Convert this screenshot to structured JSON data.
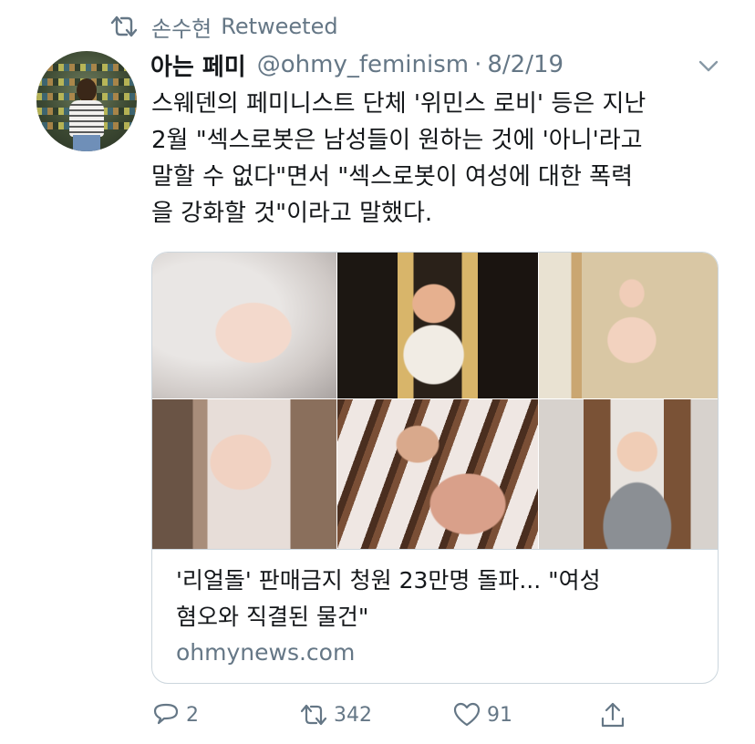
{
  "retweet": {
    "icon": "retweet-icon",
    "user": "손수현",
    "label": "Retweeted"
  },
  "tweet": {
    "author_name": "아는 페미",
    "handle": "@ohmy_feminism",
    "separator": "·",
    "date": "8/2/19",
    "text_lines": [
      "스웨덴의 페미니스트 단체 '위민스 로비' 등은 지난",
      "2월 \"섹스로봇은 남성들이 원하는 것에 '아니'라고",
      "말할 수 없다\"면서 \"섹스로봇이 여성에 대한 폭력",
      "을 강화할 것\"이라고 말했다."
    ]
  },
  "card": {
    "title_lines": [
      "'리얼돌' 판매금지 청원 23만명 돌파... \"여성",
      "혐오와 직결된 물건\""
    ],
    "domain": "ohmynews.com"
  },
  "actions": {
    "reply": {
      "icon": "reply-icon",
      "count": "2"
    },
    "retweet": {
      "icon": "retweet-icon",
      "count": "342"
    },
    "like": {
      "icon": "heart-icon",
      "count": "91"
    },
    "share": {
      "icon": "share-icon"
    }
  },
  "colors": {
    "text": "#14171a",
    "secondary": "#657786",
    "border": "#ccd6dd",
    "background": "#ffffff"
  }
}
